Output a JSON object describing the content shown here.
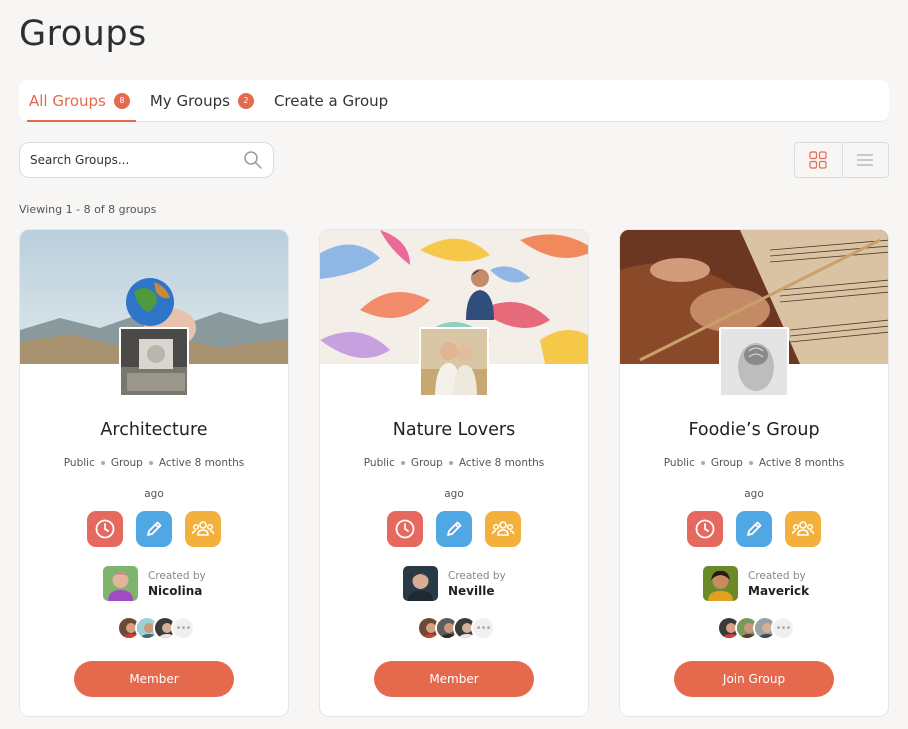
{
  "page": {
    "title": "Groups",
    "viewing_text": "Viewing 1 - 8 of 8 groups"
  },
  "tabs": [
    {
      "label": "All Groups",
      "badge": "8"
    },
    {
      "label": "My Groups",
      "badge": "2"
    },
    {
      "label": "Create a Group"
    }
  ],
  "search": {
    "placeholder": "Search Groups..."
  },
  "view_toggle": {
    "grid_icon": "grid-icon",
    "list_icon": "list-icon"
  },
  "colors": {
    "accent": "#e5694d",
    "clock": "#e5695f",
    "edit": "#4fa7e3",
    "members": "#f3b03d"
  },
  "groups": [
    {
      "name": "Architecture",
      "visibility": "Public",
      "type": "Group",
      "activity": "Active 8 months",
      "ago": "ago",
      "created_by_label": "Created by",
      "creator": "Nicolina",
      "cta": "Member"
    },
    {
      "name": "Nature Lovers",
      "visibility": "Public",
      "type": "Group",
      "activity": "Active 8 months",
      "ago": "ago",
      "created_by_label": "Created by",
      "creator": "Neville",
      "cta": "Member"
    },
    {
      "name": "Foodie’s Group",
      "visibility": "Public",
      "type": "Group",
      "activity": "Active 8 months",
      "ago": "ago",
      "created_by_label": "Created by",
      "creator": "Maverick",
      "cta": "Join Group"
    }
  ]
}
